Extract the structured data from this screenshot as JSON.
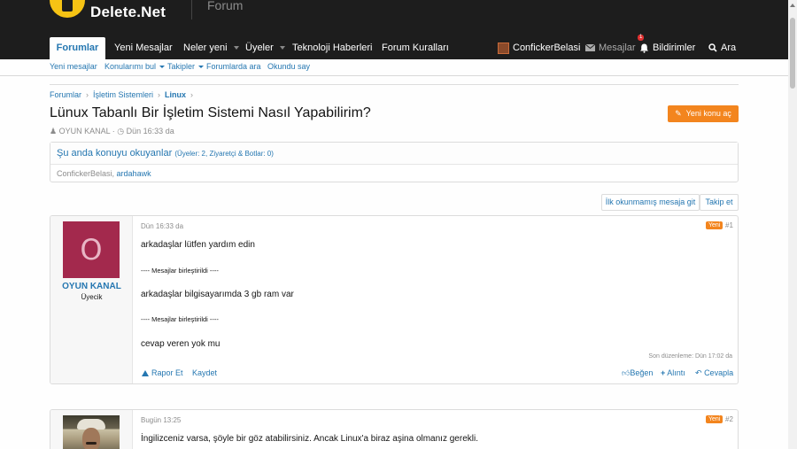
{
  "header": {
    "logo_text": "Delete.Net",
    "logo_forum": "Forum"
  },
  "nav": {
    "tabs": [
      {
        "label": "Forumlar"
      },
      {
        "label": "Yeni Mesajlar"
      },
      {
        "label": "Neler yeni"
      },
      {
        "label": "Üyeler"
      },
      {
        "label": "Teknoloji Haberleri"
      },
      {
        "label": "Forum Kuralları"
      }
    ],
    "user": "ConfickerBelasi",
    "messages": "Mesajlar",
    "alerts": "Bildirimler",
    "alerts_count": "1",
    "search": "Ara"
  },
  "subnav": {
    "items": [
      "Yeni mesajlar",
      "Konularımı bul",
      "Takipler",
      "Forumlarda ara",
      "Okundu say"
    ]
  },
  "breadcrumb": [
    "Forumlar",
    "İşletim Sistemleri",
    "Linux"
  ],
  "thread": {
    "title": "Lünux Tabanlı Bir İşletim Sistemi Nasıl Yapabilirim?",
    "new_thread_button": "Yeni konu aç",
    "author": "OYUN KANAL",
    "date": "Dün 16:33 da"
  },
  "readers": {
    "title": "Şu anda konuyu okuyanlar",
    "counts": "(Üyeler: 2, Ziyaretçi & Botlar: 0)",
    "user1": "ConfickerBelasi",
    "user2": "ardahawk"
  },
  "buttons": {
    "first_unread": "İlk okunmamış mesaja git",
    "follow": "Takip et"
  },
  "posts": [
    {
      "avatar_letter": "O",
      "username": "OYUN KANAL",
      "user_title": "Üyecik",
      "date": "Dün 16:33 da",
      "badge": "Yeni",
      "number": "#1",
      "lines": [
        "arkadaşlar lütfen yardım edin",
        "---- Mesajlar birleştirildi ----",
        "arkadaşlar bilgisayarımda 3 gb ram var",
        "---- Mesajlar birleştirildi ----",
        "cevap veren yok mu"
      ],
      "edited": "Son düzenleme: Dün 17:02 da",
      "actions": {
        "report": "Rapor Et",
        "save": "Kaydet",
        "like": "Beğen",
        "quote": "Alıntı",
        "reply": "Cevapla"
      }
    },
    {
      "date": "Bugün 13:25",
      "badge": "Yeni",
      "number": "#2",
      "text": "İngilizceniz varsa, şöyle bir göz atabilirsiniz. Ancak Linux'a biraz aşina olmanız gerekli."
    }
  ],
  "colors": {
    "header_bg": "#1d1d1d",
    "link": "#2577b1",
    "accent": "#f3851e",
    "avatar_bg": "#a3294d"
  }
}
